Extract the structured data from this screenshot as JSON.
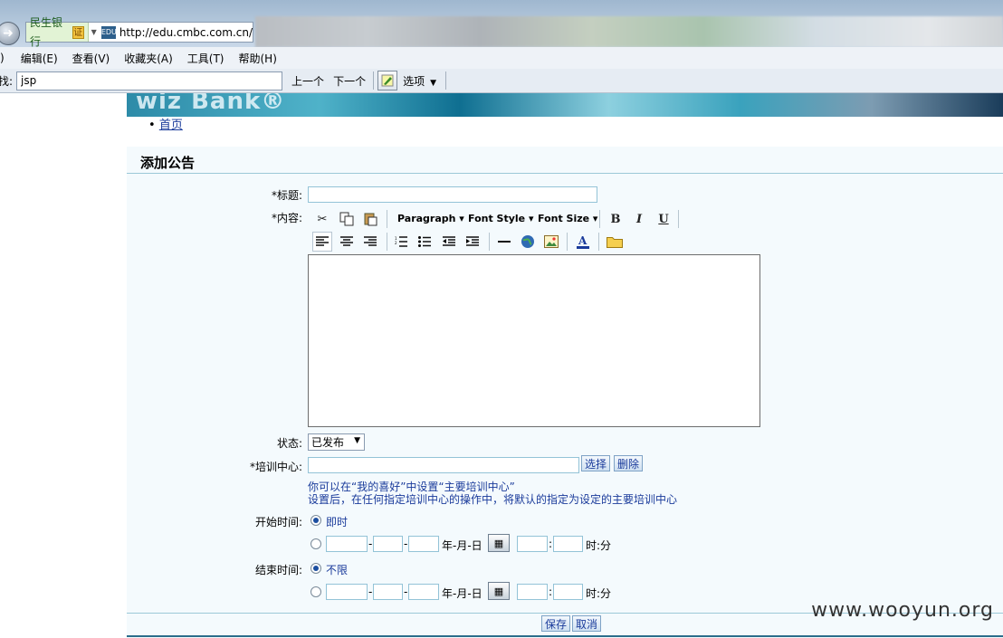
{
  "browser": {
    "site_name": "民生银行",
    "cert_badge": "证",
    "favicon_text": "EDU",
    "url": "http://edu.cmbc.com.cn/",
    "menu": [
      "编辑(E)",
      "查看(V)",
      "收藏夹(A)",
      "工具(T)",
      "帮助(H)"
    ],
    "menu_lead": ")",
    "find_label": "找:",
    "find_value": "jsp",
    "find_prev": "上一个",
    "find_next": "下一个",
    "options": "选项"
  },
  "page": {
    "banner_logo": "wiz Bank®",
    "breadcrumb": "首页",
    "title": "添加公告",
    "labels": {
      "title": "*标题:",
      "content": "*内容:",
      "status": "状态:",
      "center": "*培训中心:",
      "start": "开始时间:",
      "end": "结束时间:"
    },
    "toolbar": {
      "paragraph": "Paragraph ▾",
      "font_style": "Font Style ▾",
      "font_size": "Font Size ▾",
      "bold": "B",
      "italic": "I",
      "underline": "U"
    },
    "status_value": "已发布",
    "select_btn": "选择",
    "delete_btn": "删除",
    "hint1": "你可以在“我的喜好”中设置“主要培训中心”",
    "hint2": "设置后，在任何指定培训中心的操作中，将默认的指定为设定的主要培训中心",
    "start_immediate": "即时",
    "end_unlimited": "不限",
    "ymd": "年-月-日",
    "hm": "时:分",
    "dash": "-",
    "colon": ":",
    "save": "保存",
    "cancel": "取消"
  },
  "watermark": "www.wooyun.org"
}
